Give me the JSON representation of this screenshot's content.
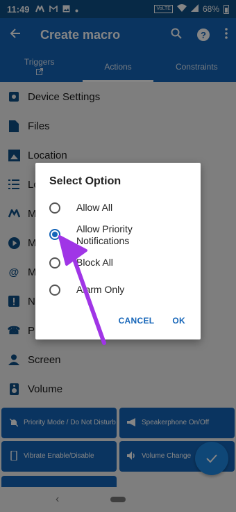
{
  "status": {
    "time": "11:49",
    "volte": "VoLTE",
    "battery": "68%"
  },
  "appbar": {
    "title": "Create macro"
  },
  "tabs": [
    {
      "label": "Triggers"
    },
    {
      "label": "Actions"
    },
    {
      "label": "Constraints"
    }
  ],
  "list": {
    "items": [
      {
        "label": "Device Settings",
        "icon": "gear-icon"
      },
      {
        "label": "Files",
        "icon": "file-icon"
      },
      {
        "label": "Location",
        "icon": "map-icon"
      },
      {
        "label": "Lo",
        "icon": "list-icon"
      },
      {
        "label": "M",
        "icon": "macrodroid-icon"
      },
      {
        "label": "M",
        "icon": "play-icon"
      },
      {
        "label": "M",
        "icon": "at-icon"
      },
      {
        "label": "N",
        "icon": "alert-icon"
      },
      {
        "label": "Pl",
        "icon": "phone-icon"
      },
      {
        "label": "Screen",
        "icon": "person-icon"
      },
      {
        "label": "Volume",
        "icon": "speaker-icon"
      }
    ]
  },
  "grid": {
    "cells": [
      {
        "label": "Priority Mode / Do Not Disturb",
        "icon": "bell-off-icon"
      },
      {
        "label": "Speakerphone On/Off",
        "icon": "megaphone-icon"
      },
      {
        "label": "Vibrate Enable/Disable",
        "icon": "vibrate-icon"
      },
      {
        "label": "Volume Change",
        "icon": "volume-icon"
      }
    ]
  },
  "dialog": {
    "title": "Select Option",
    "options": [
      {
        "label": "Allow All",
        "selected": false
      },
      {
        "label": "Allow Priority Notifications",
        "selected": true
      },
      {
        "label": "Block All",
        "selected": false
      },
      {
        "label": "Alarm Only",
        "selected": false
      }
    ],
    "cancel": "CANCEL",
    "ok": "OK"
  },
  "colors": {
    "primary": "#1565b8",
    "status_bar": "#0e4f86",
    "arrow": "#a035e6"
  }
}
